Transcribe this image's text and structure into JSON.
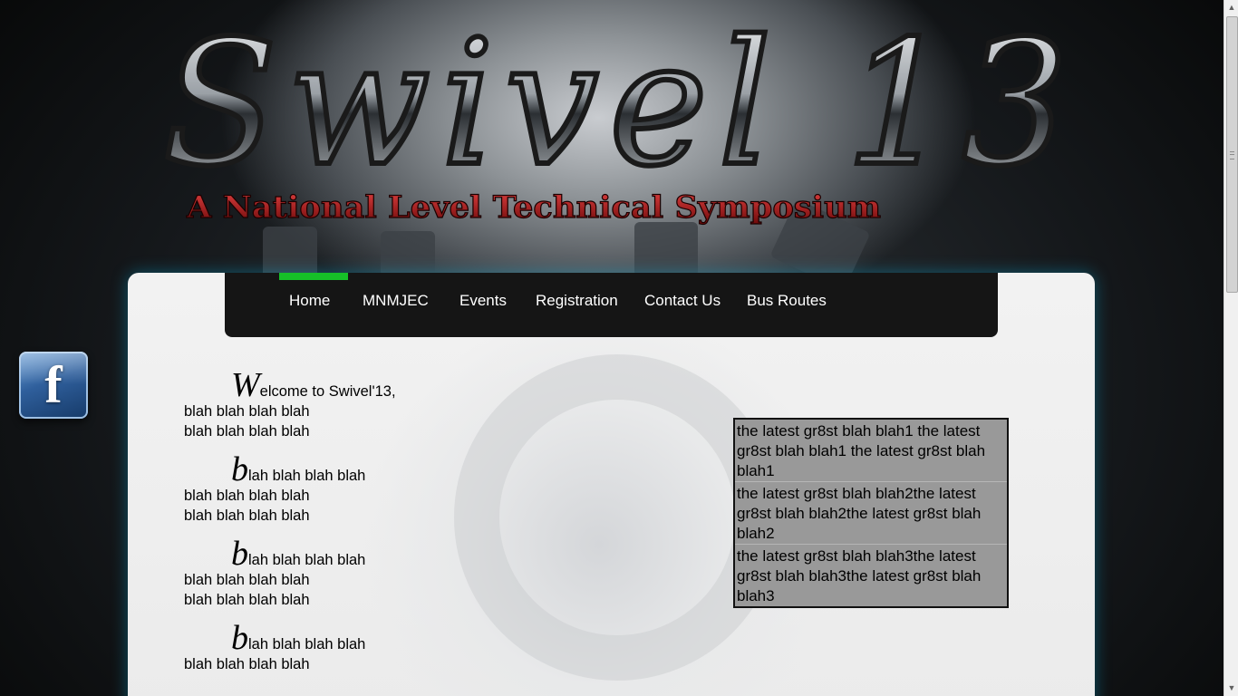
{
  "site": {
    "logo_text": "Swivel 13",
    "tagline": "A National Level Technical Symposium"
  },
  "social": {
    "facebook_glyph": "f",
    "icon": "facebook-icon"
  },
  "nav": {
    "items": [
      {
        "label": "Home",
        "active": true
      },
      {
        "label": "MNMJEC"
      },
      {
        "label": "Events"
      },
      {
        "label": "Registration"
      },
      {
        "label": "Contact Us"
      },
      {
        "label": "Bus Routes"
      }
    ],
    "active_color": "#16c028"
  },
  "main": {
    "paragraphs": [
      {
        "cap": "W",
        "rest": "elcome to Swivel'13,",
        "lines": [
          "blah blah blah blah",
          "blah blah blah blah"
        ]
      },
      {
        "cap": "b",
        "rest": "lah blah blah blah",
        "lines": [
          "blah blah blah blah",
          "blah blah blah blah"
        ]
      },
      {
        "cap": "b",
        "rest": "lah blah blah blah",
        "lines": [
          "blah blah blah blah",
          "blah blah blah blah"
        ]
      },
      {
        "cap": "b",
        "rest": "lah blah blah blah",
        "lines": [
          "blah blah blah blah"
        ]
      }
    ]
  },
  "news": {
    "items": [
      "the latest gr8st blah blah1 the latest gr8st blah blah1 the latest gr8st blah blah1",
      "the latest gr8st blah blah2the latest gr8st blah blah2the latest gr8st blah blah2",
      "the latest gr8st blah blah3the latest gr8st blah blah3the latest gr8st blah blah3"
    ]
  },
  "colors": {
    "nav_bg": "#151515",
    "news_bg": "#999999",
    "tagline_red": "#b01818"
  }
}
